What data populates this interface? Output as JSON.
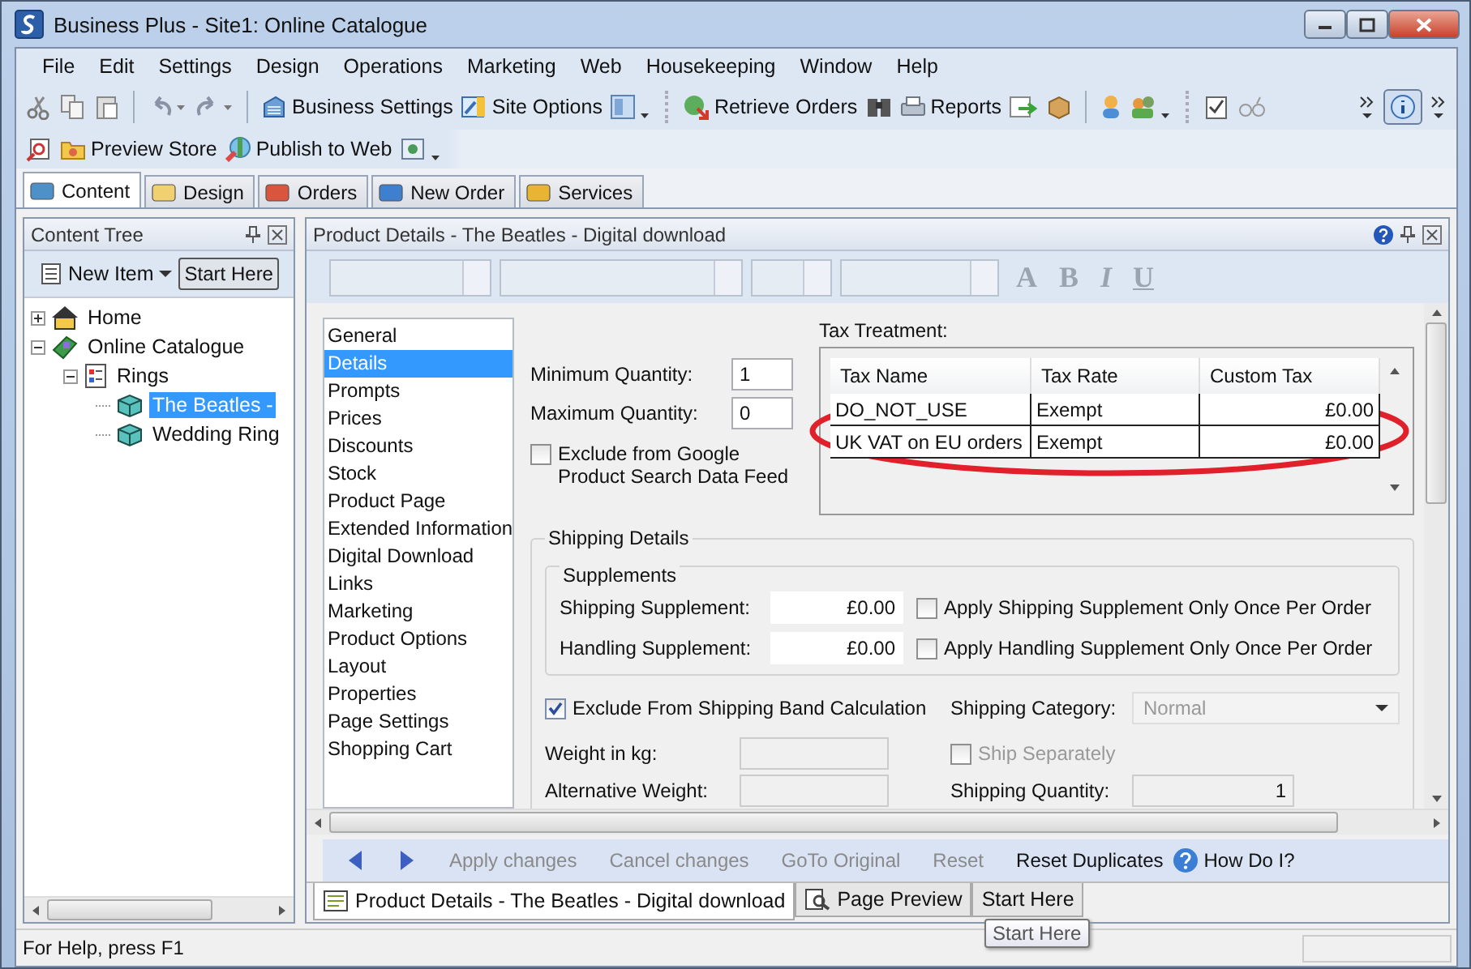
{
  "window": {
    "title": "Business Plus - Site1: Online Catalogue"
  },
  "menu": [
    "File",
    "Edit",
    "Settings",
    "Design",
    "Operations",
    "Marketing",
    "Web",
    "Housekeeping",
    "Window",
    "Help"
  ],
  "toolbar": [
    {
      "label": "Business Settings"
    },
    {
      "label": "Site Options"
    },
    {
      "label": "Retrieve Orders"
    },
    {
      "label": "Reports"
    }
  ],
  "toolbar2": [
    {
      "label": "Preview Store"
    },
    {
      "label": "Publish to Web"
    }
  ],
  "tabs": [
    {
      "label": "Content",
      "selected": true
    },
    {
      "label": "Design",
      "selected": false
    },
    {
      "label": "Orders",
      "selected": false
    },
    {
      "label": "New Order",
      "selected": false
    },
    {
      "label": "Services",
      "selected": false
    }
  ],
  "content_tree": {
    "title": "Content Tree",
    "new_item": "New Item",
    "start_here": "Start Here",
    "items": [
      {
        "label": "Home",
        "expanded": false,
        "selected": false
      },
      {
        "label": "Online Catalogue",
        "expanded": true,
        "selected": false,
        "children": [
          {
            "label": "Rings",
            "expanded": true,
            "selected": false,
            "children": [
              {
                "label": "The Beatles -",
                "selected": true
              },
              {
                "label": "Wedding Ring",
                "selected": false
              }
            ]
          }
        ]
      }
    ]
  },
  "product_details": {
    "title": "Product Details - The Beatles - Digital download",
    "format_buttons": [
      "A",
      "B",
      "I",
      "U"
    ],
    "nav": [
      {
        "label": "General",
        "selected": false
      },
      {
        "label": "Details",
        "selected": true
      },
      {
        "label": "Prompts",
        "selected": false
      },
      {
        "label": "Prices",
        "selected": false
      },
      {
        "label": "Discounts",
        "selected": false
      },
      {
        "label": "Stock",
        "selected": false
      },
      {
        "label": "Product Page",
        "selected": false
      },
      {
        "label": "Extended Information",
        "selected": false
      },
      {
        "label": "Digital Download",
        "selected": false
      },
      {
        "label": "Links",
        "selected": false
      },
      {
        "label": "Marketing",
        "selected": false
      },
      {
        "label": "Product Options",
        "selected": false
      },
      {
        "label": "Layout",
        "selected": false
      },
      {
        "label": "Properties",
        "selected": false
      },
      {
        "label": "Page Settings",
        "selected": false
      },
      {
        "label": "Shopping Cart",
        "selected": false
      }
    ],
    "min_qty": {
      "label": "Minimum Quantity:",
      "value": "1"
    },
    "max_qty": {
      "label": "Maximum Quantity:",
      "value": "0"
    },
    "google_exclude": {
      "label": "Exclude from Google Product Search Data Feed",
      "checked": false
    },
    "tax": {
      "label": "Tax Treatment:",
      "columns": [
        "Tax Name",
        "Tax Rate",
        "Custom Tax"
      ],
      "rows": [
        [
          "DO_NOT_USE",
          "Exempt",
          "£0.00"
        ],
        [
          "UK VAT on EU orders",
          "Exempt",
          "£0.00"
        ]
      ]
    },
    "shipping": {
      "title": "Shipping Details",
      "supplements_title": "Supplements",
      "supplements": [
        {
          "label": "Shipping Supplement:",
          "value": "£0.00",
          "option": "Apply Shipping Supplement Only Once Per Order",
          "checked": false
        },
        {
          "label": "Handling Supplement:",
          "value": "£0.00",
          "option": "Apply Handling Supplement Only Once Per Order",
          "checked": false
        }
      ],
      "band_exclude": {
        "label": "Exclude From Shipping Band Calculation",
        "checked": true
      },
      "category": {
        "label": "Shipping Category:",
        "value": "Normal",
        "disabled": true
      },
      "weight": {
        "label": "Weight in kg:",
        "disabled": true
      },
      "ship_separately": {
        "label": "Ship Separately",
        "checked": false,
        "disabled": true
      },
      "alt_weight": {
        "label": "Alternative Weight:",
        "disabled": true
      },
      "quantity": {
        "label": "Shipping Quantity:",
        "value": "1",
        "disabled": true
      }
    }
  },
  "actions": [
    {
      "label": "Apply changes",
      "kind": "action",
      "disabled": true
    },
    {
      "label": "Cancel changes",
      "kind": "action",
      "disabled": true
    },
    {
      "label": "GoTo Original",
      "kind": "action",
      "disabled": true
    },
    {
      "label": "Reset",
      "kind": "action",
      "disabled": true
    },
    {
      "label": "Reset Duplicates",
      "kind": "action",
      "disabled": false
    },
    {
      "label": "How Do I?",
      "kind": "help",
      "disabled": false
    }
  ],
  "doc_tabs": [
    {
      "label": "Product Details - The Beatles - Digital download",
      "selected": true
    },
    {
      "label": "Page Preview",
      "selected": false
    },
    {
      "label": "Start Here",
      "selected": false
    }
  ],
  "tooltip": "Start Here",
  "status_bar": "For Help, press F1"
}
